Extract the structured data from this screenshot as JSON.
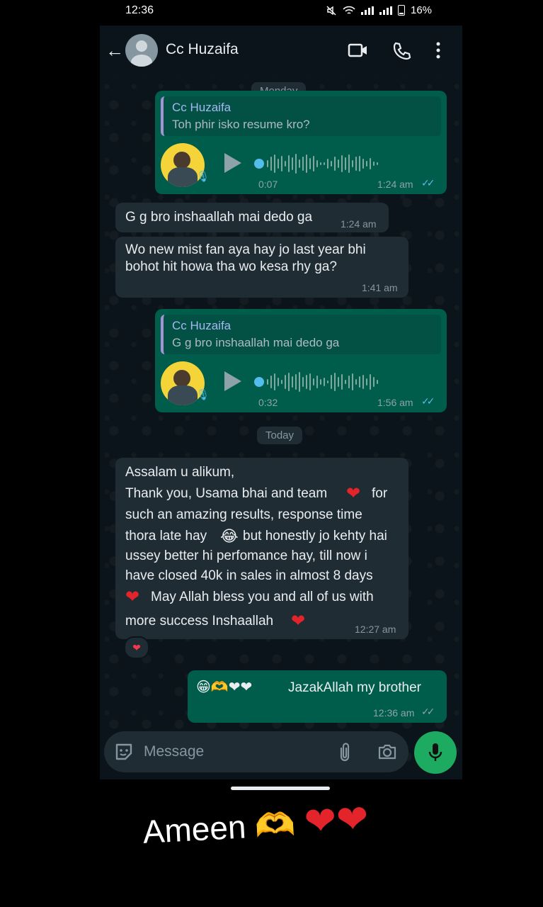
{
  "status_bar": {
    "time": "12:36",
    "battery": "16%"
  },
  "header": {
    "contact_name": "Cc Huzaifa"
  },
  "date_pills": {
    "monday": "Monday",
    "today": "Today"
  },
  "messages": {
    "m1": {
      "quote_name": "Cc Huzaifa",
      "quote_text": "Toh phir isko resume kro?",
      "duration": "0:07",
      "time": "1:24 am"
    },
    "m2": {
      "text": "G g bro inshaallah mai dedo ga",
      "time": "1:24 am"
    },
    "m3": {
      "line1": "Wo new mist fan aya hay jo last year bhi",
      "line2": "bohot hit howa tha wo kesa rhy ga?",
      "time": "1:41 am"
    },
    "m4": {
      "quote_name": "Cc Huzaifa",
      "quote_text": "G g bro inshaallah mai dedo ga",
      "duration": "0:32",
      "time": "1:56 am"
    },
    "m5": {
      "line1": "Assalam u alikum,",
      "line2a": "Thank you, Usama bhai and team",
      "line2b": "for",
      "line3": "such an amazing results, response time",
      "line4a": "thora late hay",
      "line4b": "but honestly jo kehty hai",
      "line5": "ussey better hi perfomance hay, till now i",
      "line6": "have closed 40k in sales in almost 8 days",
      "line7": "May Allah bless you and all of us with",
      "line8": "more success Inshaallah",
      "time": "12:27 am",
      "reaction": "❤"
    },
    "m6": {
      "emojis": "😁🫶❤❤",
      "text": "JazakAllah my brother",
      "time": "12:36 am"
    }
  },
  "input": {
    "placeholder": "Message"
  },
  "caption": {
    "text": "Ameen",
    "emojis": "🫶",
    "hearts": "❤❤"
  },
  "icons": [
    "back-arrow-icon",
    "avatar-icon",
    "video-call-icon",
    "voice-call-icon",
    "more-options-icon",
    "sticker-icon",
    "attach-icon",
    "camera-icon",
    "mic-icon",
    "play-icon"
  ],
  "colors": {
    "outgoing": "#005c4b",
    "incoming": "#1f2c34",
    "accent_green": "#1daa61",
    "tick_blue": "#53bdeb"
  }
}
